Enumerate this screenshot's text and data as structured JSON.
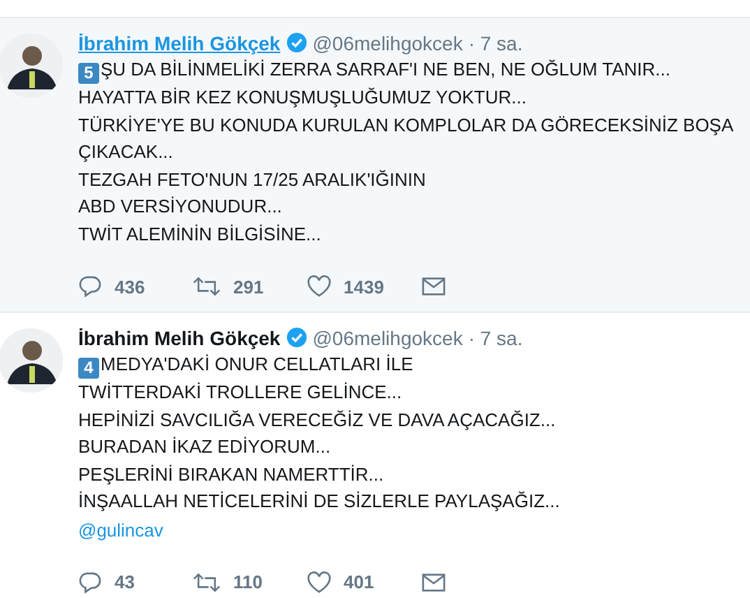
{
  "tweets": [
    {
      "hovered": true,
      "name": "İbrahim Melih Gökçek",
      "verified": true,
      "handle": "@06melihgokcek",
      "time": "· 7 sa.",
      "number": "5",
      "lines": [
        "ŞU DA BİLİNMELİKİ ZERRA SARRAF'I NE BEN, NE OĞLUM TANIR...",
        "HAYATTA BİR KEZ KONUŞMUŞLUĞUMUZ YOKTUR...",
        "TÜRKİYE'YE BU KONUDA KURULAN KOMPLOLAR DA GÖRECEKSİNİZ BOŞA",
        "ÇIKACAK...",
        "TEZGAH FETO'NUN 17/25 ARALIK'IĞININ",
        "ABD VERSİYONUDUR...",
        "TWİT ALEMİNİN BİLGİSİNE..."
      ],
      "replies": "436",
      "retweets": "291",
      "likes": "1439"
    },
    {
      "hovered": false,
      "name": "İbrahim Melih Gökçek",
      "verified": true,
      "handle": "@06melihgokcek",
      "time": "· 7 sa.",
      "number": "4",
      "lines": [
        "MEDYA'DAKİ ONUR CELLATLARI İLE",
        "TWİTTERDAKİ TROLLERE GELİNCE...",
        "HEPİNİZİ SAVCILIĞA VERECEĞİZ VE DAVA AÇACAĞIZ...",
        "BURADAN İKAZ EDİYORUM...",
        "PEŞLERİNİ BIRAKAN NAMERTTİR...",
        "İNŞAALLAH NETİCELERİNİ DE SİZLERLE PAYLAŞAĞIZ..."
      ],
      "mention": "@gulincav",
      "replies": "43",
      "retweets": "110",
      "likes": "401"
    }
  ]
}
